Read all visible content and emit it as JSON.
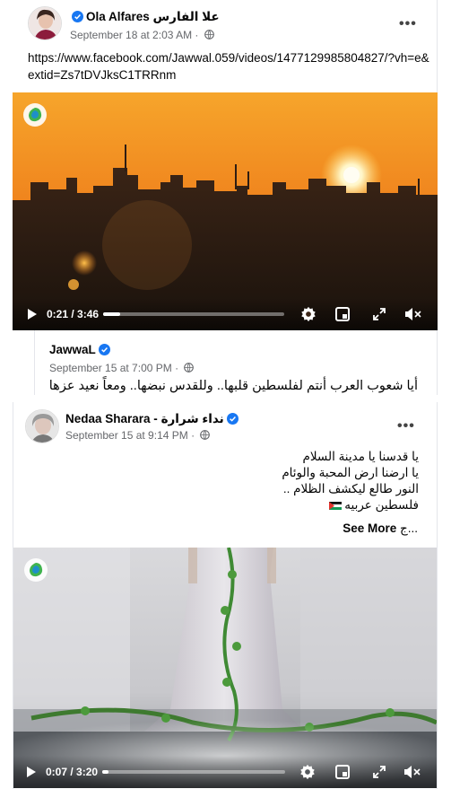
{
  "post1": {
    "author": "Ola Alfares علا الفارس",
    "timestamp": "September 18 at 2:03 AM",
    "more_label": "•••",
    "link_text": "https://www.facebook.com/Jawwal.059/videos/1477129985804827/?vh=e&extid=Zs7tDVJksC1TRRnm",
    "video": {
      "current_time": "0:21",
      "duration": "3:46",
      "time_display": "0:21 / 3:46",
      "progress": 0.093
    },
    "shared": {
      "author": "JawwaL",
      "timestamp": "September 15 at 7:00 PM",
      "text": "أيا شعوب العرب أنتم لفلسطين قلبها.. وللقدس نبضها.. ومعاً نعيد عزها"
    }
  },
  "post2": {
    "author": "Nedaa Sharara - نداء شرارة",
    "timestamp": "September 15 at 9:14 PM",
    "more_label": "•••",
    "lines": [
      "يا قدسنا يا مدينة السلام",
      "يا ارضنا ارض المحبة والوئام",
      "النور طالع ليكشف الظلام ..",
      "فلسطين عربيه"
    ],
    "truncated_prefix": "ج...",
    "see_more": "See More",
    "video": {
      "current_time": "0:07",
      "duration": "3:20",
      "time_display": "0:07 / 3:20",
      "progress": 0.035
    }
  },
  "icons": [
    "verified-badge-icon",
    "globe-icon",
    "play-icon",
    "settings-icon",
    "miniplayer-icon",
    "fullscreen-icon",
    "mute-icon",
    "jawwal-logo-icon",
    "palestine-flag-icon"
  ],
  "colors": {
    "verified": "#1877f2",
    "meta_text": "#65676b",
    "sunset_orange": "#f28a1c"
  }
}
